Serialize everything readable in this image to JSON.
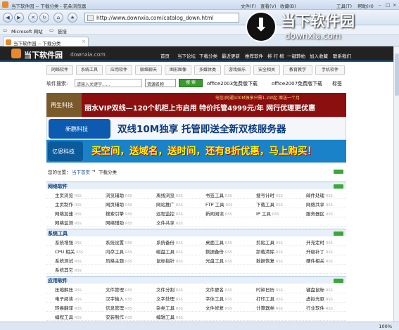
{
  "window": {
    "title": "当下软件园 -- 下载分类 - 花朵浏览器",
    "menus": [
      "文件(F)",
      "查看(V)",
      "收藏(B)",
      "工具(T)",
      "帮助(H)"
    ]
  },
  "address": {
    "url": "http://www.downxia.com/catalog_down.html"
  },
  "favorites": [
    {
      "label": "Microsoft 网站"
    },
    {
      "label": "链接"
    }
  ],
  "tab": {
    "label": "当下软件园 -- 下载分类"
  },
  "site": {
    "logo_text": "当下软件园",
    "logo_domain": "downxia.com",
    "nav": [
      "首页",
      "当下论坛",
      "下载分类",
      "最近更新",
      "推荐软件",
      "排 行 榜",
      "一键转帖",
      "加入收藏",
      "联系我们"
    ]
  },
  "brand_overlay": {
    "name": "当下软件园",
    "domain": "downxia.com"
  },
  "categories": [
    "网络软件",
    "系统工具",
    "应用软件",
    "联络聊天",
    "图形图像",
    "多媒体类",
    "游戏娱乐",
    "安全相关",
    "教育教学",
    "手机软件"
  ],
  "search": {
    "label": "软件搜索:",
    "placeholder": "请输入关键字......",
    "select": "资源名称",
    "button": "搜 索",
    "hot": [
      "office2003免费版下载",
      "office2007免费版下载",
      "标签"
    ]
  },
  "banners": {
    "b1_logo": "再生科技",
    "b1_top": "电信/网通100M独享只需1.2W起 赠送一个月",
    "b1_main": "丽水VIP双线—120个机柜上市启用 特价托管4999元/年 网行优理更优惠",
    "b2_logo": "新鹏科技",
    "b2_main": "双线10M独享 托管即送全新双核服务器",
    "b3_logo": "亿恩科技",
    "b3_main": "买空间，送域名，送时间，还有8折优惠，马上购买！"
  },
  "breadcrumb": {
    "prefix": "您的位置：",
    "home": "当下首页",
    "sep": "→",
    "current": "下载分类",
    "tag": "RSS"
  },
  "rss": "RSS",
  "sections": [
    {
      "title": "网络软件",
      "rows": [
        [
          "主页浏览",
          "浏览辅助",
          "离线浏览",
          "书签工具",
          "搜号计时",
          "邮件处理"
        ],
        [
          "主页制作",
          "网页辅助",
          "网站推广",
          "FTP 工具",
          "下载工具",
          "网络共享"
        ],
        [
          "网络加速",
          "搜索引擎",
          "远程监控",
          "新闻阅读",
          "IP 工具",
          "服务器区"
        ],
        [
          "网络监测",
          "网络辅助",
          "文件共享",
          "",
          "",
          ""
        ]
      ]
    },
    {
      "title": "系统工具",
      "rows": [
        [
          "系统增强",
          "系统设置",
          "系统备份",
          "桌面工具",
          "剪贴工具",
          "开充定时"
        ],
        [
          "CPU 相关",
          "内存工具",
          "磁盘工具",
          "数据备份",
          "卸载清除",
          "升级补丁"
        ],
        [
          "系统测试",
          "风格主题",
          "鼠标指针",
          "光盘工具",
          "数据恢复",
          "硬件相关"
        ],
        [
          "系统其它",
          "",
          "",
          "",
          "",
          ""
        ]
      ]
    },
    {
      "title": "应用软件",
      "rows": [
        [
          "压缩解压",
          "文件管理",
          "文件分割",
          "文件更名",
          "时钟日历",
          "键盘鼠标"
        ],
        [
          "电子阅读",
          "汉字输入",
          "文字处理",
          "字体工具",
          "打印工具",
          "虚拟光驱"
        ],
        [
          "转换翻译",
          "信息管理",
          "杂类工具",
          "文件修复",
          "计算器类",
          "行业软件"
        ],
        [
          "编程工具",
          "安装制作",
          "编辑工具",
          "",
          "",
          ""
        ]
      ]
    }
  ],
  "status": {
    "zoom": "100%"
  }
}
